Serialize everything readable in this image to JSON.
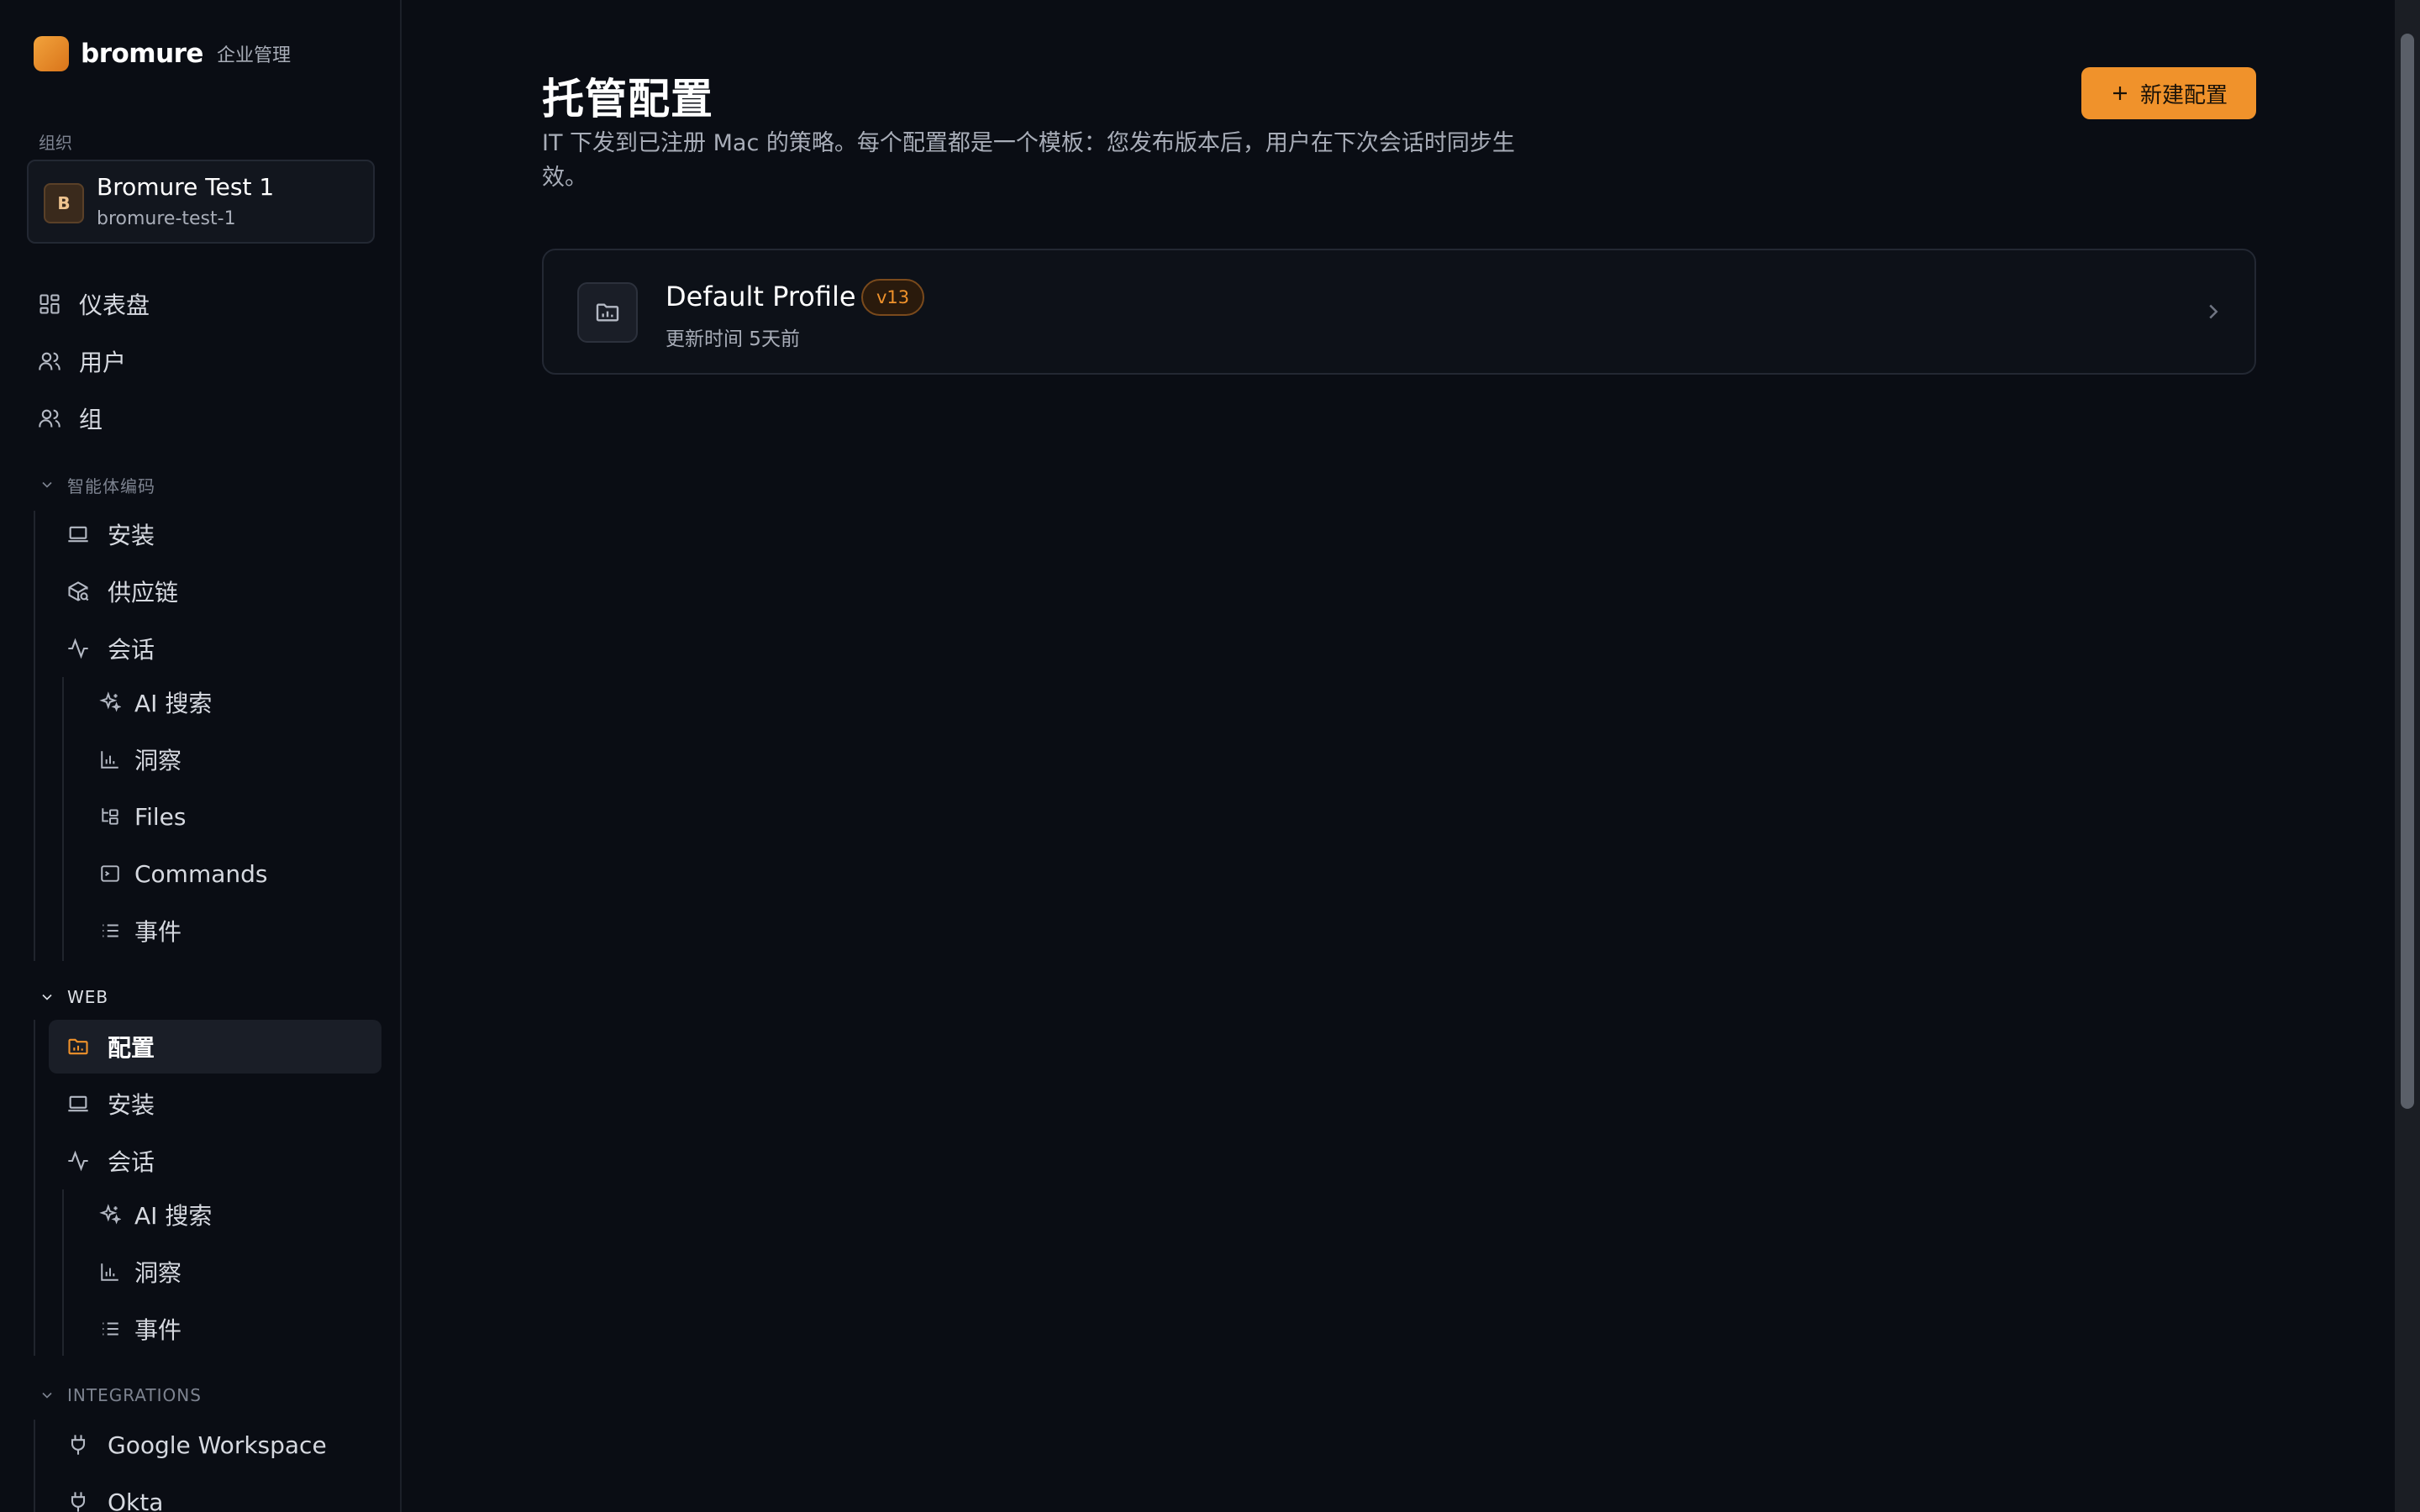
{
  "brand": {
    "name": "bromure",
    "subtitle": "企业管理"
  },
  "org": {
    "section_label": "组织",
    "avatar_letter": "B",
    "name": "Bromure Test 1",
    "slug": "bromure-test-1"
  },
  "nav": {
    "dashboard": "仪表盘",
    "users": "用户",
    "groups": "组"
  },
  "agent_coding": {
    "header": "智能体编码",
    "install": "安装",
    "supply_chain": "供应链",
    "sessions": "会话",
    "ai_search": "AI 搜索",
    "insights": "洞察",
    "files": "Files",
    "commands": "Commands",
    "events": "事件"
  },
  "web": {
    "header": "WEB",
    "profiles": "配置",
    "install": "安装",
    "sessions": "会话",
    "ai_search": "AI 搜索",
    "insights": "洞察",
    "events": "事件"
  },
  "integrations": {
    "header": "INTEGRATIONS",
    "google": "Google Workspace",
    "okta": "Okta"
  },
  "main": {
    "title": "托管配置",
    "description": "IT 下发到已注册 Mac 的策略。每个配置都是一个模板：您发布版本后，用户在下次会话时同步生效。",
    "new_button": "新建配置"
  },
  "profiles": [
    {
      "name": "Default Profile",
      "version": "v13",
      "updated": "更新时间 5天前"
    }
  ],
  "colors": {
    "accent": "#f0922b",
    "background": "#0a0d14",
    "card": "#0d1118"
  }
}
